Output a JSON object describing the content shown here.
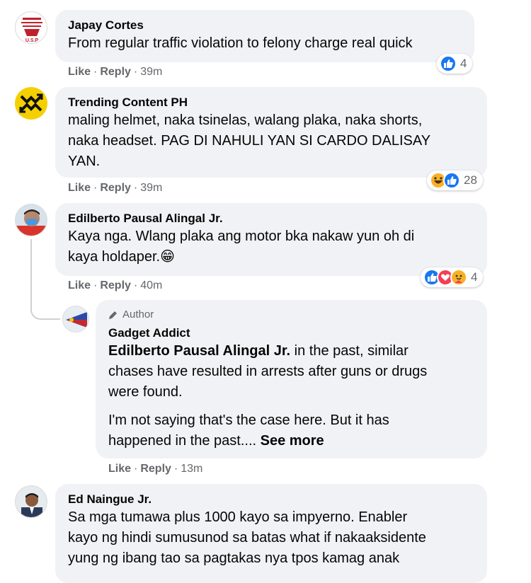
{
  "comments": [
    {
      "author": "Japay Cortes",
      "avatar_text": "U.S.P",
      "text": "From regular traffic violation to felony charge real quick",
      "like": "Like",
      "reply": "Reply",
      "time": "39m",
      "reaction_count": "4"
    },
    {
      "author": "Trending Content PH",
      "text_lines": [
        "maling helmet, naka tsinelas, walang plaka, naka shorts,",
        "naka headset. PAG DI NAHULI YAN SI CARDO DALISAY",
        "YAN."
      ],
      "like": "Like",
      "reply": "Reply",
      "time": "39m",
      "reaction_count": "28"
    },
    {
      "author": "Edilberto Pausal Alingal Jr.",
      "text_lines": [
        "Kaya nga. Wlang plaka ang motor bka nakaw yun oh di",
        "kaya holdaper.😁"
      ],
      "like": "Like",
      "reply": "Reply",
      "time": "40m",
      "reaction_count": "4"
    },
    {
      "badge": "Author",
      "author": "Gadget Addict",
      "mention": "Edilberto Pausal Alingal Jr.",
      "text_lines": [
        " in the past, similar",
        "chases have resulted in arrests after guns or drugs",
        "were found."
      ],
      "para2_lines": [
        "I'm not saying that's the case here. But it has",
        "happened in the past.... "
      ],
      "see_more": "See more",
      "like": "Like",
      "reply": "Reply",
      "time": "13m"
    },
    {
      "author": "Ed Naingue Jr.",
      "text_lines": [
        "Sa mga tumawa plus 1000 kayo sa impyerno. Enabler",
        "kayo ng hindi sumusunod sa batas what if nakaaksidente",
        "yung ng ibang tao sa pagtakas nya tpos kamag anak"
      ]
    }
  ],
  "colors": {
    "bubble": "#f0f2f5",
    "like_blue": "#1877f2",
    "love_red": "#f33e58",
    "haha_yellow": "#f7b125",
    "meta_gray": "#65676b"
  }
}
